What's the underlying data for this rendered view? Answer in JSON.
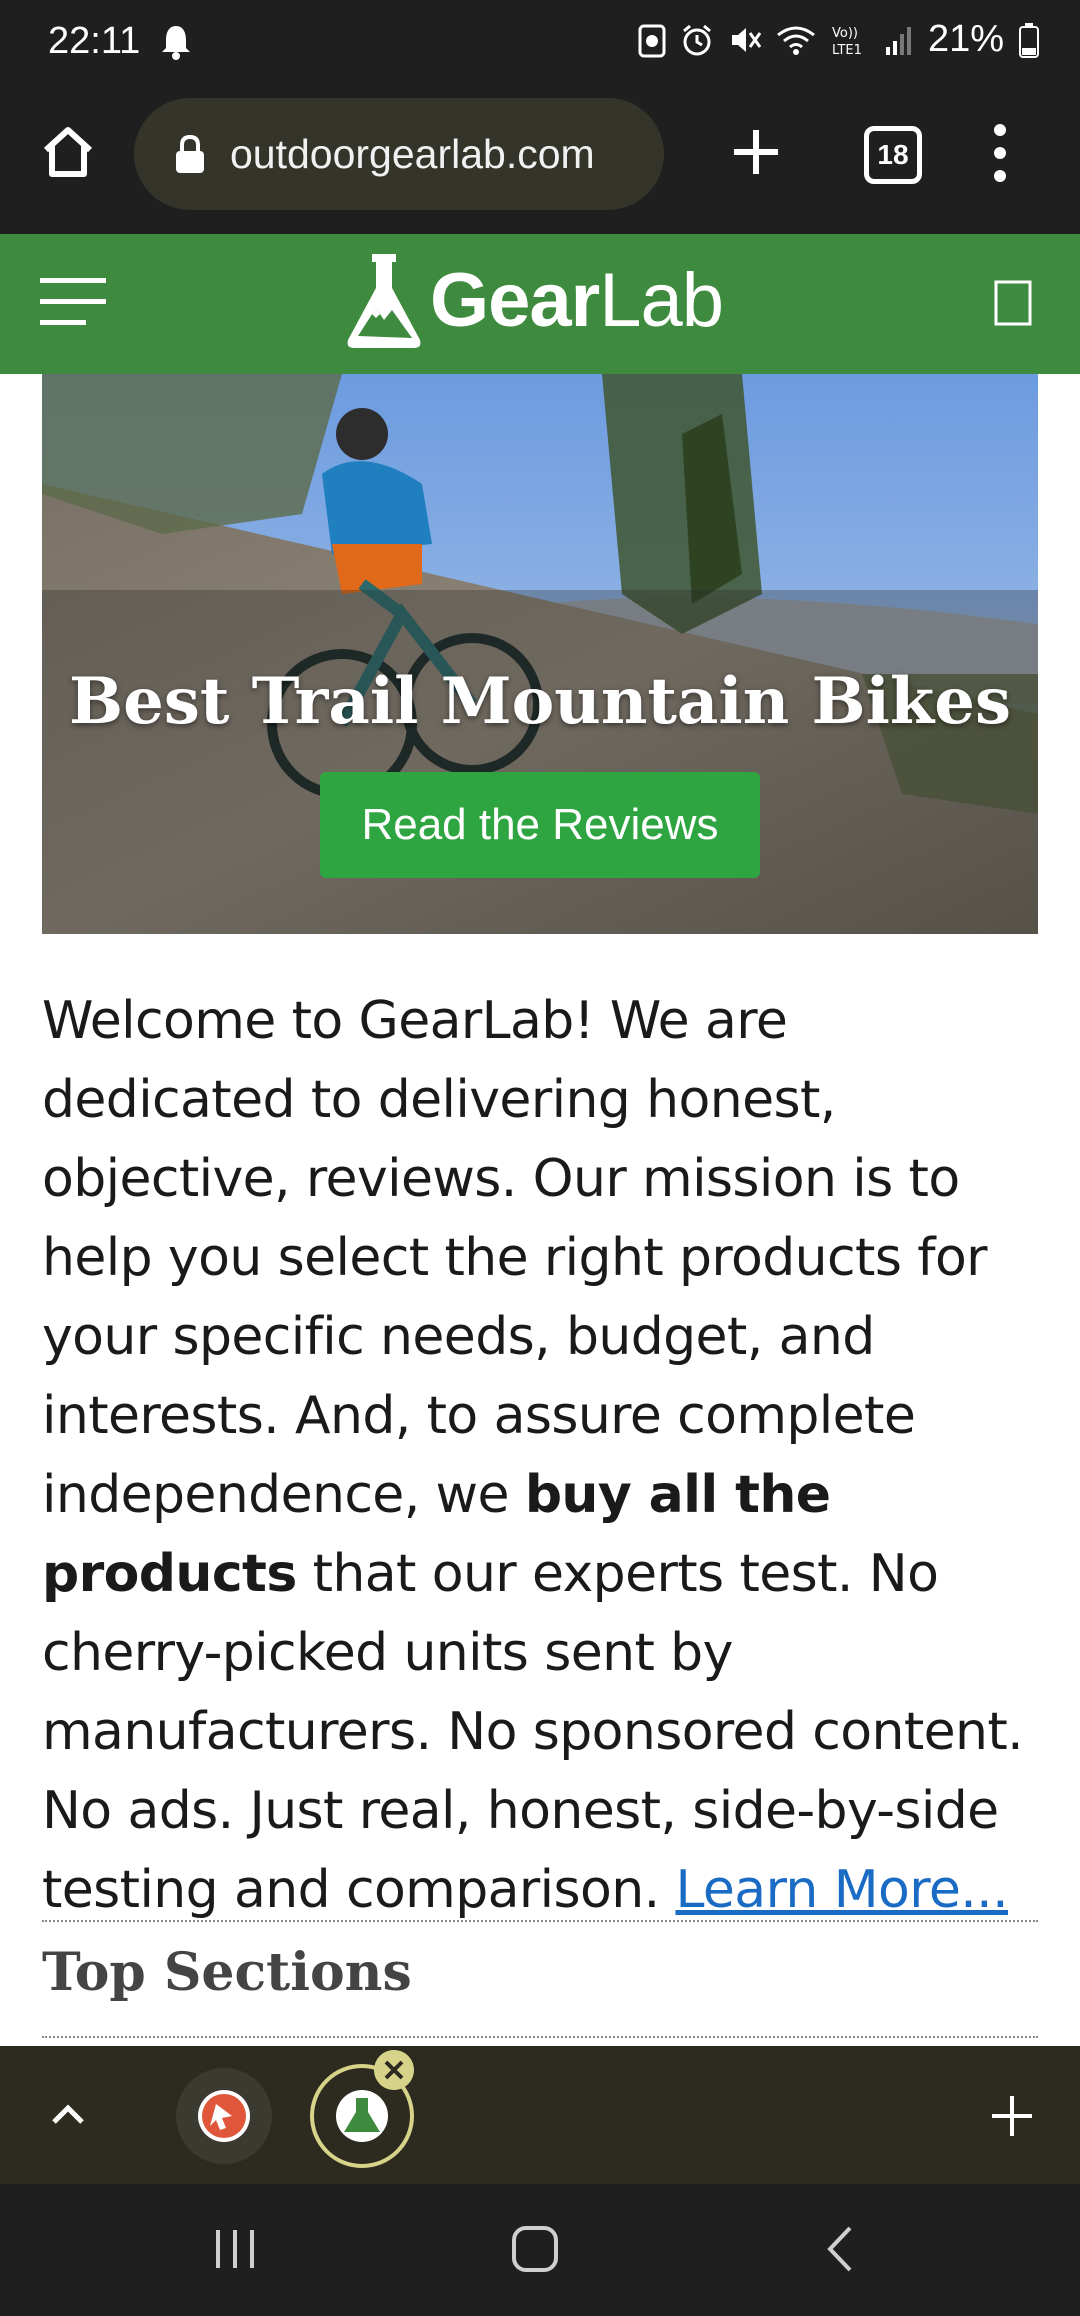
{
  "status_bar": {
    "time": "22:11",
    "battery": "21%"
  },
  "browser": {
    "url": "outdoorgearlab.com",
    "tab_count": "18"
  },
  "site_header": {
    "logo_bold": "Gear",
    "logo_light": "Lab"
  },
  "hero": {
    "title": "Best Trail Mountain Bikes",
    "cta_label": "Read the Reviews"
  },
  "intro": {
    "text_1": "Welcome to GearLab! We are dedicated to delivering honest, objective, reviews. Our mission is to help you select the right products for your specific needs, budget, and interests. And, to assure complete independence, we ",
    "bold": "buy all the products",
    "text_2": " that our experts test. No cherry-picked units sent by manufacturers. No sponsored content. No ads. Just real, honest, side-by-side testing and comparison. ",
    "link": "Learn More..."
  },
  "sections": {
    "title": "Top Sections"
  },
  "colors": {
    "site_green": "#3e8a3e",
    "cta_green": "#2fa542",
    "link_blue": "#1a6bc4"
  }
}
